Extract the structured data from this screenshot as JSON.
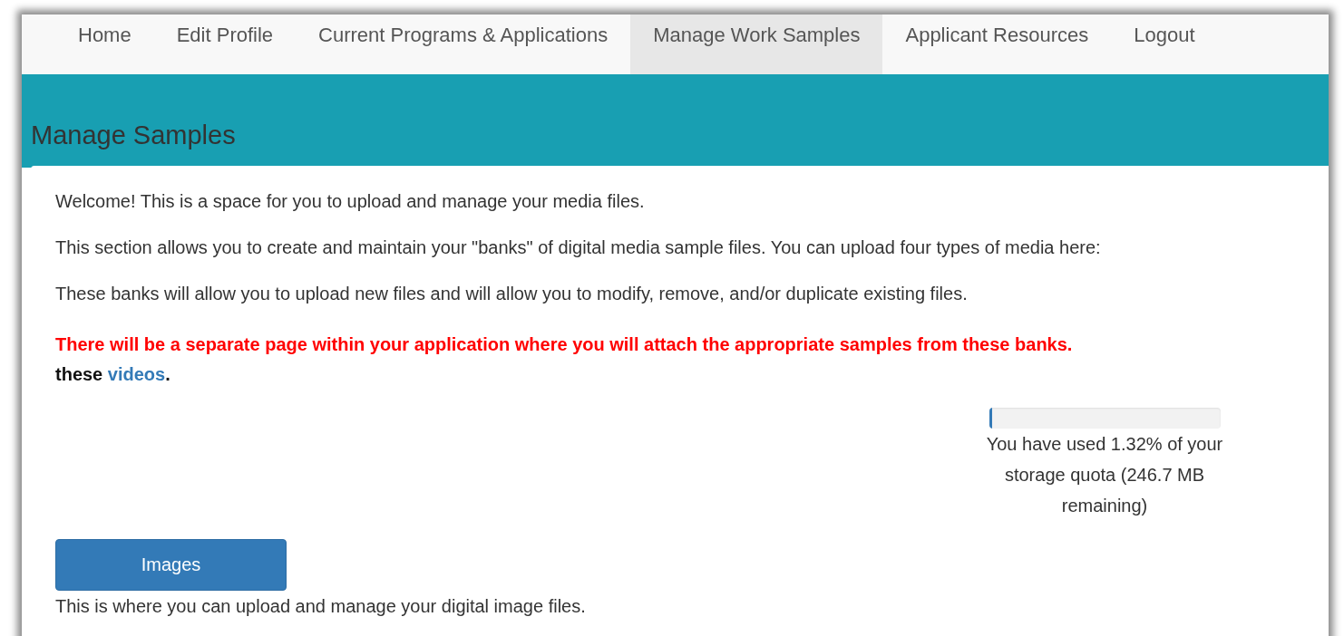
{
  "nav": [
    {
      "label": "Home",
      "selected": false
    },
    {
      "label": "Edit Profile",
      "selected": false
    },
    {
      "label": "Current Programs & Applications",
      "selected": false
    },
    {
      "label": "Manage Work Samples",
      "selected": true
    },
    {
      "label": "Applicant Resources",
      "selected": false
    },
    {
      "label": "Logout",
      "selected": false
    }
  ],
  "page_title": "Manage Samples",
  "intro": [
    "Welcome! This is a space for you to upload and manage your media files.",
    "This section allows you to create and maintain your \"banks\" of digital media sample files. You can upload four types of media here:",
    "These banks will allow you to upload new files and will allow you to modify, remove, and/or duplicate existing files."
  ],
  "notice": {
    "warning": "There will be a separate page within your application where you will attach the appropriate samples from these banks.",
    "lead": "these",
    "link": "videos",
    "tail": "."
  },
  "storage": {
    "level": 0.0132,
    "text": "You have used 1.32% of your storage quota (246.7 MB remaining)"
  },
  "sections": [
    {
      "button": "Images",
      "description": "This is where you can upload and manage your digital image files."
    }
  ]
}
